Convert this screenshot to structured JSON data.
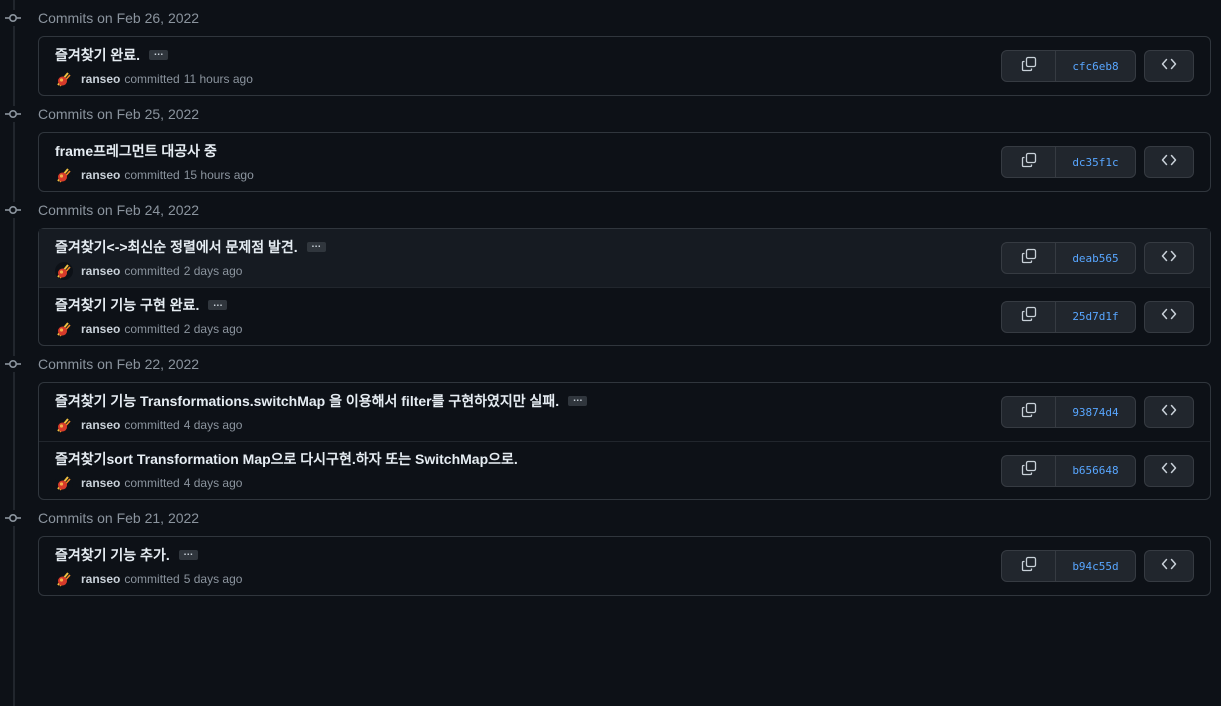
{
  "groups": [
    {
      "title": "Commits on Feb 26, 2022",
      "commits": [
        {
          "message": "즐겨찾기 완료.",
          "has_ellipsis": true,
          "author": "ranseo",
          "committed_label": "committed",
          "time": "11 hours ago",
          "sha": "cfc6eb8",
          "highlighted": false
        }
      ]
    },
    {
      "title": "Commits on Feb 25, 2022",
      "commits": [
        {
          "message": "frame프레그먼트 대공사 중",
          "has_ellipsis": false,
          "author": "ranseo",
          "committed_label": "committed",
          "time": "15 hours ago",
          "sha": "dc35f1c",
          "highlighted": false
        }
      ]
    },
    {
      "title": "Commits on Feb 24, 2022",
      "commits": [
        {
          "message": "즐겨찾기<->최신순 정렬에서 문제점 발견.",
          "has_ellipsis": true,
          "author": "ranseo",
          "committed_label": "committed",
          "time": "2 days ago",
          "sha": "deab565",
          "highlighted": true
        },
        {
          "message": "즐겨찾기 기능 구현 완료.",
          "has_ellipsis": true,
          "author": "ranseo",
          "committed_label": "committed",
          "time": "2 days ago",
          "sha": "25d7d1f",
          "highlighted": false
        }
      ]
    },
    {
      "title": "Commits on Feb 22, 2022",
      "commits": [
        {
          "message": "즐겨찾기 기능 Transformations.switchMap 을 이용해서 filter를 구현하였지만 실패.",
          "has_ellipsis": true,
          "author": "ranseo",
          "committed_label": "committed",
          "time": "4 days ago",
          "sha": "93874d4",
          "highlighted": false
        },
        {
          "message": "즐겨찾기sort Transformation Map으로 다시구현.하자 또는 SwitchMap으로.",
          "has_ellipsis": false,
          "author": "ranseo",
          "committed_label": "committed",
          "time": "4 days ago",
          "sha": "b656648",
          "highlighted": false
        }
      ]
    },
    {
      "title": "Commits on Feb 21, 2022",
      "commits": [
        {
          "message": "즐겨찾기 기능 추가.",
          "has_ellipsis": true,
          "author": "ranseo",
          "committed_label": "committed",
          "time": "5 days ago",
          "sha": "b94c55d",
          "highlighted": false
        }
      ]
    }
  ],
  "ellipsis_label": "…",
  "icons": {
    "commit": "git-commit-icon",
    "copy": "copy-icon",
    "browse": "code-icon",
    "avatar": "avatar-icon"
  },
  "colors": {
    "background": "#0d1117",
    "sha_link": "#58a6ff",
    "border": "#30363d",
    "highlight_row": "#161b22"
  }
}
